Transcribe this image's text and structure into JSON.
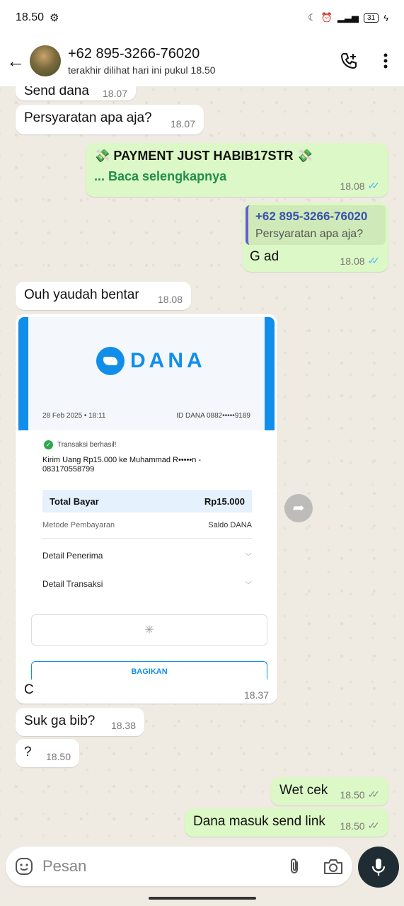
{
  "status_bar": {
    "time": "18.50",
    "battery": "31"
  },
  "header": {
    "contact_name": "+62 895-3266-76020",
    "last_seen": "terakhir dilihat hari ini pukul 18.50"
  },
  "messages": [
    {
      "dir": "in",
      "text": "Send dana",
      "time": "18.07"
    },
    {
      "dir": "in",
      "text": "Persyaratan apa aja?",
      "time": "18.07"
    },
    {
      "dir": "out",
      "title": "💸 PAYMENT JUST HABIB17STR 💸",
      "read_more": "... Baca selengkapnya",
      "time": "18.08",
      "status": "read"
    },
    {
      "dir": "out",
      "quote_name": "+62 895-3266-76020",
      "quote_text": "Persyaratan apa aja?",
      "text": "G ad",
      "time": "18.08",
      "status": "read"
    },
    {
      "dir": "in",
      "text": "Ouh yaudah bentar",
      "time": "18.08"
    },
    {
      "dir": "in",
      "type": "image",
      "caption": "C",
      "time": "18.37"
    },
    {
      "dir": "in",
      "text": "Suk ga bib?",
      "time": "18.38"
    },
    {
      "dir": "in",
      "text": "?",
      "time": "18.50"
    },
    {
      "dir": "out",
      "text": "Wet cek",
      "time": "18.50",
      "status": "delivered"
    },
    {
      "dir": "out",
      "text": "Dana masuk send link",
      "time": "18.50",
      "status": "delivered"
    }
  ],
  "receipt": {
    "brand": "DANA",
    "date": "28 Feb 2025 • 18:11",
    "id": "ID DANA 0882•••••9189",
    "status": "Transaksi berhasil!",
    "description": "Kirim Uang Rp15.000 ke Muhammad R•••••n - 083170558799",
    "total_label": "Total Bayar",
    "total_value": "Rp15.000",
    "method_label": "Metode Pembayaran",
    "method_value": "Saldo DANA",
    "detail_recipient": "Detail Penerima",
    "detail_transaction": "Detail Transaksi",
    "share_label": "BAGIKAN"
  },
  "input": {
    "placeholder": "Pesan"
  },
  "colors": {
    "accent": "#118eea",
    "outgoing_bubble": "#dcf8c6",
    "read_tick": "#4fb6ec"
  }
}
